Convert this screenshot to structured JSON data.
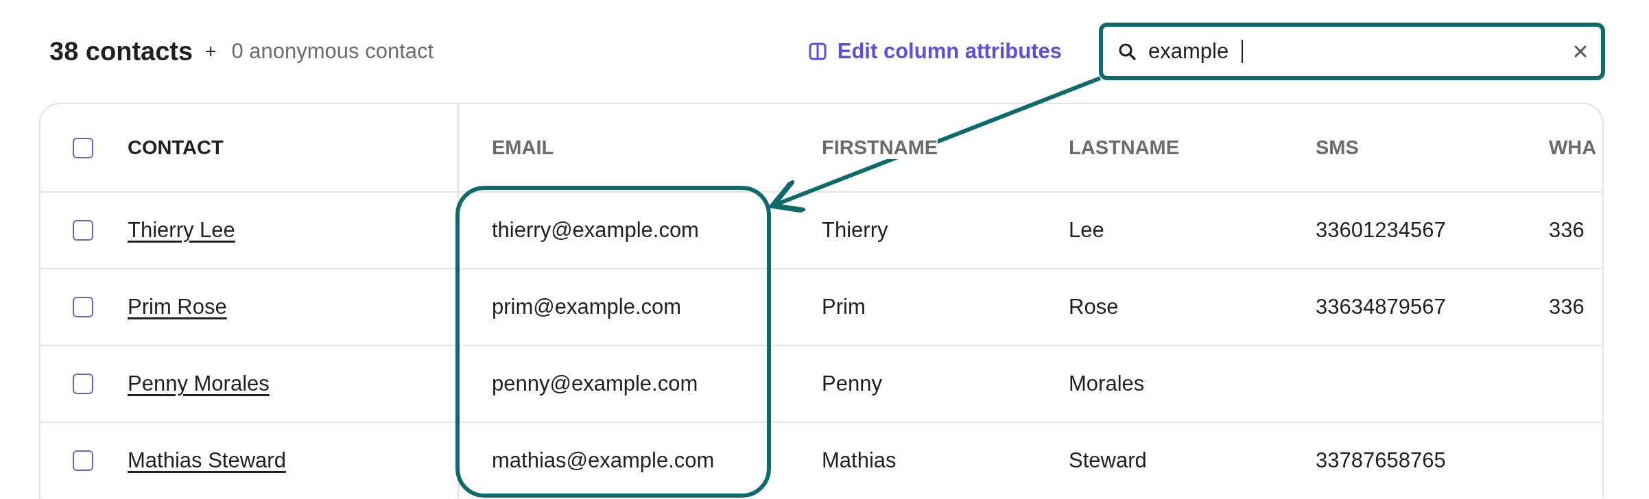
{
  "header": {
    "title": "38 contacts",
    "separator": "+",
    "subtitle": "0 anonymous contact"
  },
  "edit_columns_link": "Edit column attributes",
  "search": {
    "value": "example"
  },
  "table": {
    "select_all_checked": false,
    "columns": [
      "CONTACT",
      "EMAIL",
      "FIRSTNAME",
      "LASTNAME",
      "SMS",
      "WHA"
    ],
    "rows": [
      {
        "selected": false,
        "cells": [
          "Thierry Lee",
          "thierry@example.com",
          "Thierry",
          "Lee",
          "33601234567",
          "336"
        ]
      },
      {
        "selected": false,
        "cells": [
          "Prim Rose",
          "prim@example.com",
          "Prim",
          "Rose",
          "33634879567",
          "336"
        ]
      },
      {
        "selected": false,
        "cells": [
          "Penny Morales",
          "penny@example.com",
          "Penny",
          "Morales",
          "",
          ""
        ]
      },
      {
        "selected": false,
        "cells": [
          "Mathias Steward",
          "mathias@example.com",
          "Mathias",
          "Steward",
          "33787658765",
          ""
        ]
      }
    ]
  }
}
